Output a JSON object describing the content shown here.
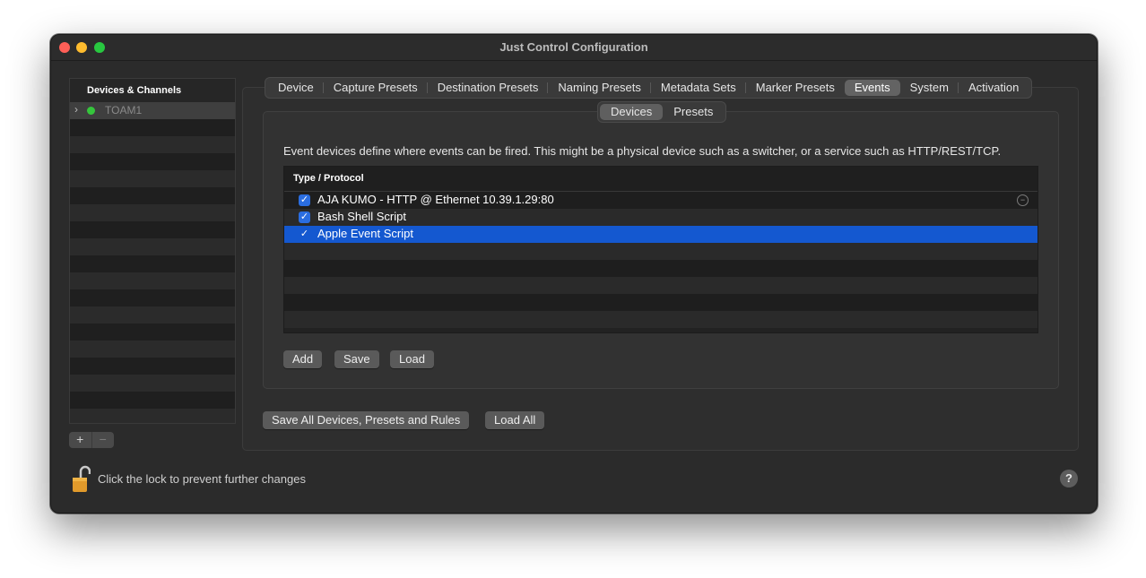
{
  "window": {
    "title": "Just Control Configuration"
  },
  "sidebar": {
    "header": "Devices & Channels",
    "items": [
      {
        "label": "TOAM1",
        "status_color": "#35c53c"
      }
    ],
    "add_label": "+",
    "remove_label": "−"
  },
  "tabs": [
    {
      "label": "Device"
    },
    {
      "label": "Capture Presets"
    },
    {
      "label": "Destination Presets"
    },
    {
      "label": "Naming Presets"
    },
    {
      "label": "Metadata Sets"
    },
    {
      "label": "Marker Presets"
    },
    {
      "label": "Events",
      "active": true
    },
    {
      "label": "System"
    },
    {
      "label": "Activation"
    }
  ],
  "segments": [
    {
      "label": "Devices",
      "active": true
    },
    {
      "label": "Presets"
    }
  ],
  "events": {
    "description": "Event devices define where events can be fired. This might be a physical device such as a switcher, or a service such as HTTP/REST/TCP.",
    "column_header": "Type / Protocol",
    "rows": [
      {
        "label": "AJA KUMO - HTTP @ Ethernet 10.39.1.29:80",
        "checked": true
      },
      {
        "label": "Bash Shell Script",
        "checked": true
      },
      {
        "label": "Apple Event Script",
        "checked": true,
        "selected": true
      }
    ],
    "add_label": "Add",
    "save_label": "Save",
    "load_label": "Load"
  },
  "footer": {
    "save_all_label": "Save All Devices, Presets and Rules",
    "load_all_label": "Load All",
    "lock_message": "Click the lock to prevent further changes",
    "help_label": "?"
  },
  "colors": {
    "selection": "#1458d0",
    "status_green": "#35c53c"
  }
}
